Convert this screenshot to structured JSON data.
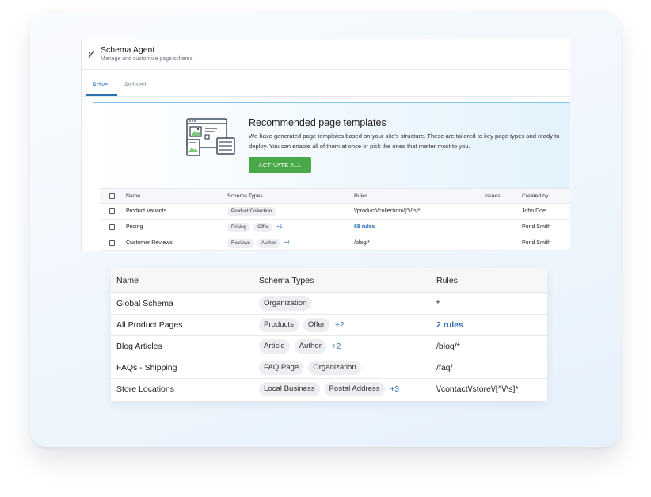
{
  "app": {
    "title": "Schema Agent",
    "subtitle": "Manage and customize page schema"
  },
  "tabs": [
    {
      "label": "Active",
      "active": true
    },
    {
      "label": "Archived",
      "active": false
    }
  ],
  "recommendation": {
    "title": "Recommended page templates",
    "description": "We have generated page templates based on your site's structure. These are tailored to key page types and ready to deploy. You can enable all of them at once or pick the ones that matter most to you.",
    "button_label": "ACTIVATE ALL",
    "columns": {
      "name": "Name",
      "schema_types": "Schema Types",
      "rules": "Rules",
      "issues": "Issues",
      "created_by": "Created by"
    },
    "rows": [
      {
        "name": "Product Variants",
        "chips": [
          "Product Collection"
        ],
        "more": "",
        "rules": "\\/product\\/collection\\/[^\\/\\s]*",
        "rules_is_link": false,
        "issues": "",
        "created_by": "John Doe"
      },
      {
        "name": "Pricing",
        "chips": [
          "Pricing",
          "Offer"
        ],
        "more": "+1",
        "rules": "88 rules",
        "rules_is_link": true,
        "issues": "",
        "created_by": "Pond Smith"
      },
      {
        "name": "Customer Reviews",
        "chips": [
          "Reviews",
          "Author"
        ],
        "more": "+4",
        "rules": "/blog/*",
        "rules_is_link": false,
        "issues": "",
        "created_by": "Pond Smith"
      }
    ]
  },
  "schemas_table": {
    "columns": {
      "name": "Name",
      "schema_types": "Schema Types",
      "rules": "Rules"
    },
    "rows": [
      {
        "name": "Global Schema",
        "chips": [
          "Organization"
        ],
        "more": "",
        "rules": "*",
        "rules_is_link": false
      },
      {
        "name": "All Product Pages",
        "chips": [
          "Products",
          "Offer"
        ],
        "more": "+2",
        "rules": "2 rules",
        "rules_is_link": true
      },
      {
        "name": "Blog Articles",
        "chips": [
          "Article",
          "Author"
        ],
        "more": "+2",
        "rules": "/blog/*",
        "rules_is_link": false
      },
      {
        "name": "FAQs - Shipping",
        "chips": [
          "FAQ Page",
          "Organization"
        ],
        "more": "",
        "rules": "/faq/",
        "rules_is_link": false
      },
      {
        "name": "Store Locations",
        "chips": [
          "Local Business",
          "Postal Address"
        ],
        "more": "+3",
        "rules": "\\/contact\\/store\\/[^\\/\\s]*",
        "rules_is_link": false
      }
    ]
  },
  "colors": {
    "accent": "#2a6fb4",
    "button_green": "#49a848",
    "panel_border": "#86c3ea"
  }
}
